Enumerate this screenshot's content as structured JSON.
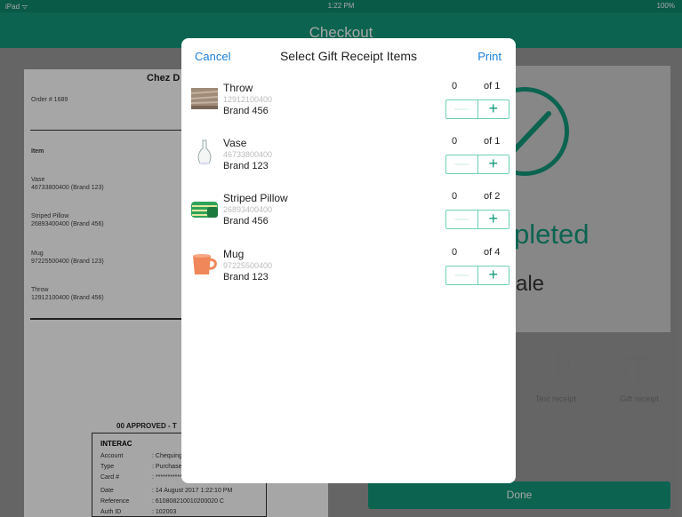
{
  "status": {
    "carrier": "iPad ᯤ",
    "time": "1:22 PM",
    "battery": "100%"
  },
  "nav": {
    "title": "Checkout"
  },
  "receipt": {
    "store": "Chez D",
    "order": "Order # 1689",
    "item_header": "Item",
    "lines": [
      {
        "name": "Vase",
        "detail": "46733800400 (Brand 123)"
      },
      {
        "name": "Striped Pillow",
        "detail": "26893400400 (Brand 456)"
      },
      {
        "name": "Mug",
        "detail": "97225500400 (Brand 123)"
      },
      {
        "name": "Throw",
        "detail": "12912100400 (Brand 456)"
      }
    ],
    "approved": "00 APPROVED - T",
    "interac": {
      "header": "INTERAC",
      "rows": [
        {
          "label": "Account",
          "value": ": Chequing"
        },
        {
          "label": "Type",
          "value": ": Purchase"
        },
        {
          "label": "Card #",
          "value": ": ************"
        },
        {
          "label": "Date",
          "value": ": 14 August 2017 1:22:10 PM"
        },
        {
          "label": "Reference",
          "value": ": 610808210010200020 C"
        },
        {
          "label": "Auth ID",
          "value": ": 102003"
        }
      ]
    }
  },
  "right": {
    "completed": "pleted",
    "sale": "ale",
    "text_receipt": "Text receipt",
    "gift_receipt": "Gift receipt",
    "done": "Done"
  },
  "modal": {
    "cancel": "Cancel",
    "title": "Select Gift Receipt Items",
    "print": "Print",
    "items": [
      {
        "name": "Throw",
        "sku": "12912100400",
        "brand": "Brand 456",
        "qty": "0",
        "of": "of 1",
        "minus": "—",
        "plus": "+"
      },
      {
        "name": "Vase",
        "sku": "46733800400",
        "brand": "Brand 123",
        "qty": "0",
        "of": "of 1",
        "minus": "—",
        "plus": "+"
      },
      {
        "name": "Striped Pillow",
        "sku": "26893400400",
        "brand": "Brand 456",
        "qty": "0",
        "of": "of 2",
        "minus": "—",
        "plus": "+"
      },
      {
        "name": "Mug",
        "sku": "97225500400",
        "brand": "Brand 123",
        "qty": "0",
        "of": "of 4",
        "minus": "—",
        "plus": "+"
      }
    ]
  },
  "colors": {
    "accent": "#139a7b",
    "link": "#1a7fd8"
  }
}
